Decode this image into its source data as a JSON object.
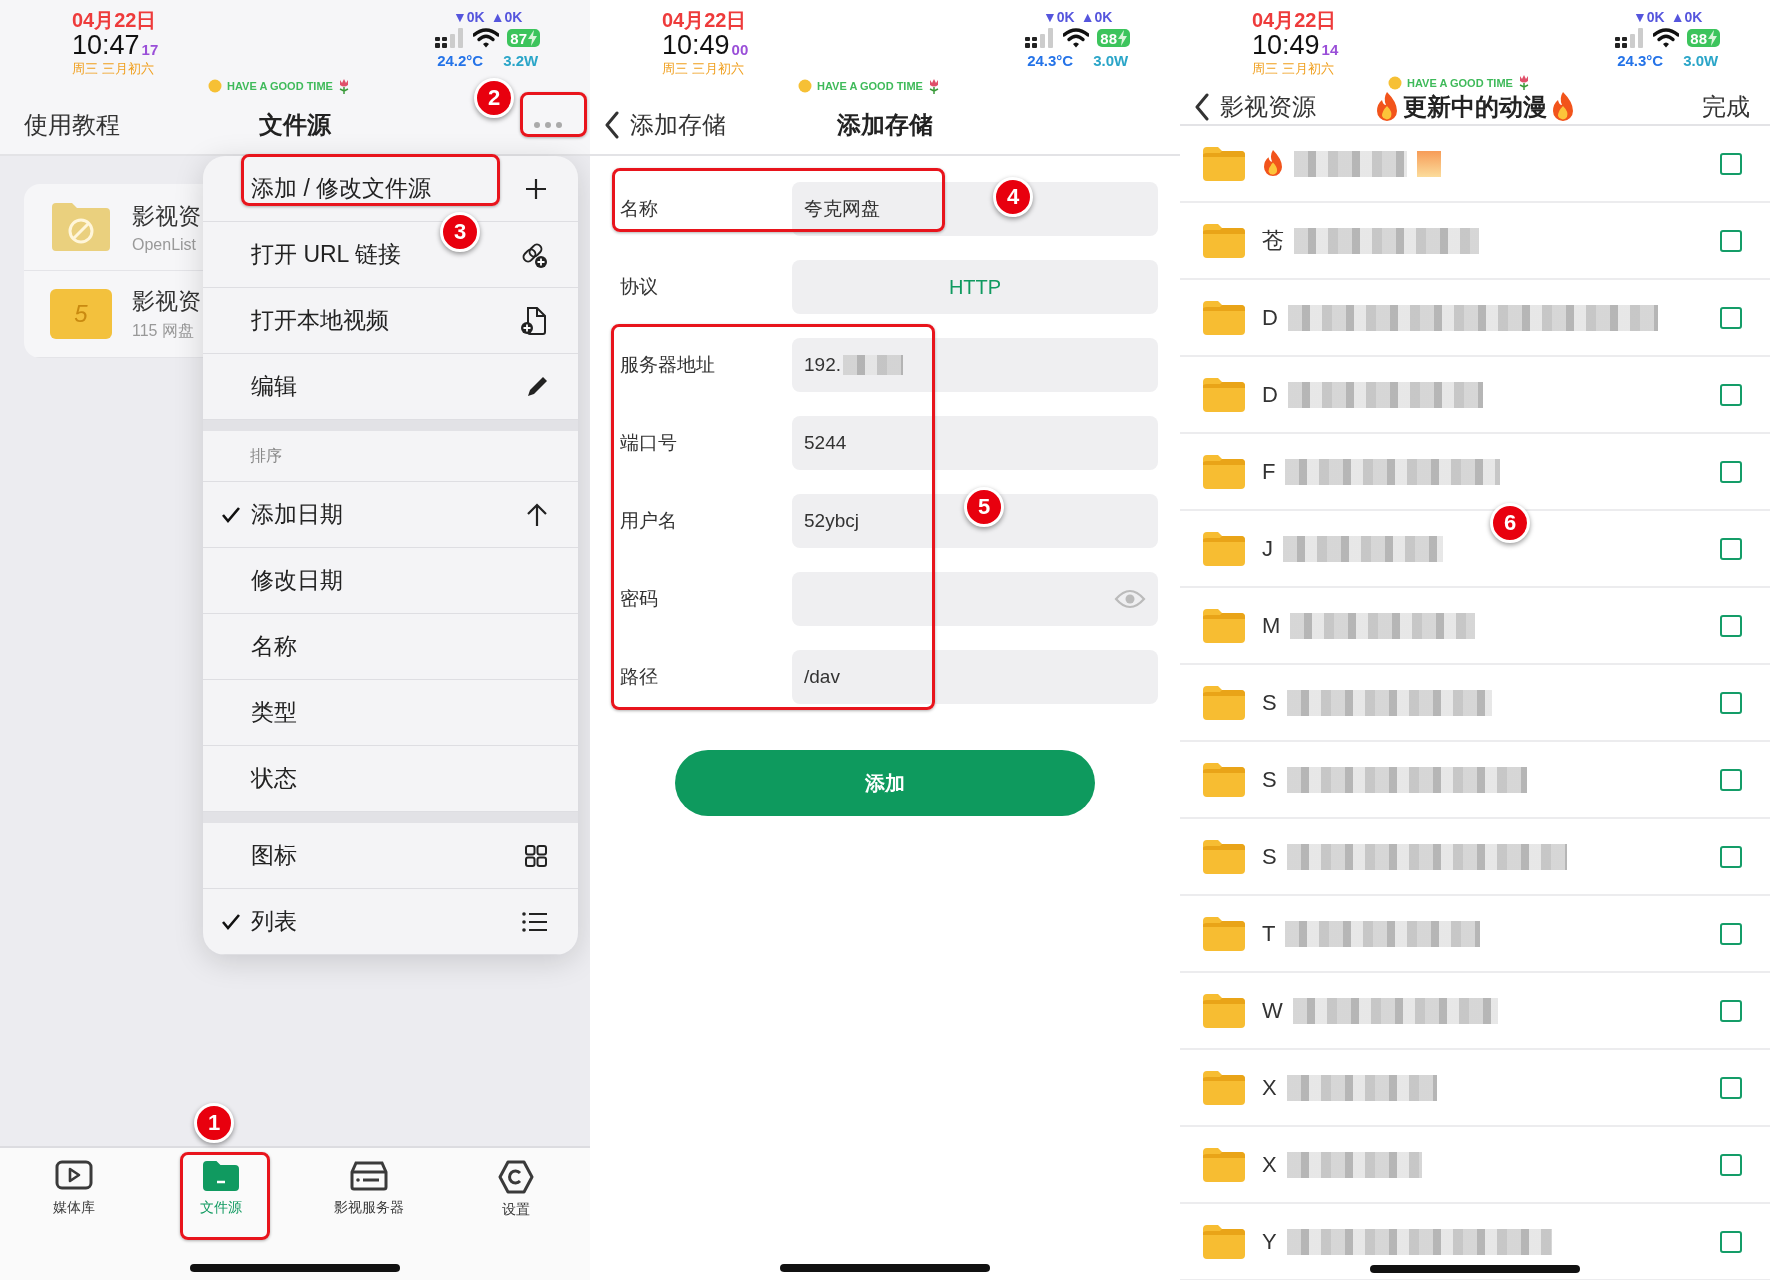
{
  "screens": [
    {
      "kind": "sources",
      "status_bar": {
        "date": "04月22日",
        "time": "10:47",
        "seconds": "17",
        "lunar": "周三 三月初六",
        "download": "▼0K",
        "upload": "▲0K",
        "battery": "87",
        "temperature": "24.2°C",
        "power": "3.2W",
        "motto": "HAVE A GOOD TIME"
      },
      "nav": {
        "left": "使用教程",
        "title": "文件源"
      },
      "sources": [
        {
          "name": "影视资",
          "subtitle": "OpenList",
          "kind": "blocked"
        },
        {
          "name": "影视资",
          "subtitle": "115 网盘",
          "kind": "numbered",
          "folder_label": "5"
        }
      ],
      "menu": {
        "actions": [
          {
            "label": "添加 / 修改文件源",
            "checked": false
          },
          {
            "label": "打开 URL 链接",
            "checked": false
          },
          {
            "label": "打开本地视频",
            "checked": false
          },
          {
            "label": "编辑",
            "checked": false
          }
        ],
        "sort_header": "排序",
        "sort_options": [
          {
            "label": "添加日期",
            "checked": true
          },
          {
            "label": "修改日期",
            "checked": false
          },
          {
            "label": "名称",
            "checked": false
          },
          {
            "label": "类型",
            "checked": false
          },
          {
            "label": "状态",
            "checked": false
          }
        ],
        "view_options": [
          {
            "label": "图标",
            "checked": false
          },
          {
            "label": "列表",
            "checked": true
          }
        ]
      },
      "tab_bar": [
        {
          "label": "媒体库",
          "selected": false
        },
        {
          "label": "文件源",
          "selected": true
        },
        {
          "label": "影视服务器",
          "selected": false
        },
        {
          "label": "设置",
          "selected": false
        }
      ],
      "annotations": [
        {
          "number": "1"
        },
        {
          "number": "2"
        },
        {
          "number": "3"
        }
      ]
    },
    {
      "kind": "add_storage",
      "status_bar": {
        "date": "04月22日",
        "time": "10:49",
        "seconds": "00",
        "lunar": "周三 三月初六",
        "download": "▼0K",
        "upload": "▲0K",
        "battery": "88",
        "temperature": "24.3°C",
        "power": "3.0W",
        "motto": "HAVE A GOOD TIME"
      },
      "nav": {
        "left": "添加存储",
        "title": "添加存储"
      },
      "fields": [
        {
          "label": "名称",
          "kind": "text",
          "value": "夸克网盘",
          "redacted": false
        },
        {
          "label": "协议",
          "kind": "select",
          "value": "HTTP",
          "redacted": false
        },
        {
          "label": "服务器地址",
          "kind": "text",
          "value": "192.",
          "redacted": true
        },
        {
          "label": "端口号",
          "kind": "text",
          "value": "5244",
          "redacted": false
        },
        {
          "label": "用户名",
          "kind": "text",
          "value": "52ybcj",
          "redacted": false
        },
        {
          "label": "密码",
          "kind": "password",
          "redacted": false
        },
        {
          "label": "路径",
          "kind": "text",
          "value": "/dav",
          "redacted": false
        }
      ],
      "submit": "添加",
      "annotations": [
        {
          "number": "4"
        },
        {
          "number": "5"
        }
      ]
    },
    {
      "kind": "folder_list",
      "status_bar": {
        "date": "04月22日",
        "time": "10:49",
        "seconds": "14",
        "lunar": "周三 三月初六",
        "download": "▼0K",
        "upload": "▲0K",
        "battery": "88",
        "temperature": "24.3°C",
        "power": "3.0W",
        "motto": "HAVE A GOOD TIME"
      },
      "nav": {
        "left": "影视资源",
        "title": "更新中的动漫",
        "right": "完成"
      },
      "folders": [
        {
          "kind": "flame",
          "checked": false
        },
        {
          "kind": "text",
          "prefix": "苍",
          "checked": false
        },
        {
          "kind": "text",
          "prefix": "D",
          "checked": false
        },
        {
          "kind": "text",
          "prefix": "D",
          "checked": false
        },
        {
          "kind": "text",
          "prefix": "F",
          "checked": false
        },
        {
          "kind": "text",
          "prefix": "J",
          "checked": false
        },
        {
          "kind": "text",
          "prefix": "M",
          "checked": false
        },
        {
          "kind": "text",
          "prefix": "S",
          "checked": false
        },
        {
          "kind": "text",
          "prefix": "S",
          "checked": false
        },
        {
          "kind": "text",
          "prefix": "S",
          "checked": false
        },
        {
          "kind": "text",
          "prefix": "T",
          "checked": false
        },
        {
          "kind": "text",
          "prefix": "W",
          "checked": false
        },
        {
          "kind": "text",
          "prefix": "X",
          "checked": false
        },
        {
          "kind": "text",
          "prefix": "X",
          "checked": false
        },
        {
          "kind": "text",
          "prefix": "Y",
          "checked": false
        }
      ],
      "annotations": [
        {
          "number": "6"
        }
      ]
    }
  ]
}
